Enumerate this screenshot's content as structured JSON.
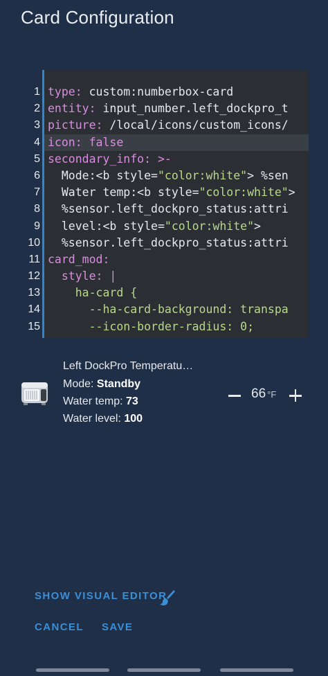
{
  "header": {
    "title": "Card Configuration"
  },
  "editor": {
    "line_numbers": [
      "1",
      "2",
      "3",
      "4",
      "5",
      "6",
      "7",
      "8",
      "9",
      "10",
      "11",
      "12",
      "13",
      "14",
      "15"
    ],
    "lines": [
      {
        "indent": "",
        "parts": [
          {
            "c": "k",
            "t": "type:"
          },
          {
            "c": "p",
            "t": " custom:numberbox-card"
          }
        ]
      },
      {
        "indent": "",
        "parts": [
          {
            "c": "k",
            "t": "entity:"
          },
          {
            "c": "p",
            "t": " input_number.left_dockpro_t"
          }
        ]
      },
      {
        "indent": "",
        "parts": [
          {
            "c": "k",
            "t": "picture:"
          },
          {
            "c": "p",
            "t": " /local/icons/custom_icons/"
          }
        ]
      },
      {
        "indent": "",
        "active": true,
        "parts": [
          {
            "c": "k",
            "t": "icon:"
          },
          {
            "c": "p",
            "t": " "
          },
          {
            "c": "k",
            "t": "false"
          }
        ]
      },
      {
        "indent": "",
        "parts": [
          {
            "c": "k",
            "t": "secondary_info:"
          },
          {
            "c": "p",
            "t": " "
          },
          {
            "c": "k",
            "t": ">-"
          }
        ]
      },
      {
        "indent": "  ",
        "parts": [
          {
            "c": "p",
            "t": "Mode:<b style="
          },
          {
            "c": "s",
            "t": "\"color:white\""
          },
          {
            "c": "p",
            "t": "> %sen"
          }
        ]
      },
      {
        "indent": "  ",
        "parts": [
          {
            "c": "p",
            "t": "Water temp:<b style="
          },
          {
            "c": "s",
            "t": "\"color:white\""
          },
          {
            "c": "p",
            "t": ">"
          }
        ]
      },
      {
        "indent": "  ",
        "parts": [
          {
            "c": "p",
            "t": "%sensor.left_dockpro_status:attri"
          }
        ]
      },
      {
        "indent": "  ",
        "parts": [
          {
            "c": "p",
            "t": "level:<b style="
          },
          {
            "c": "s",
            "t": "\"color:white\""
          },
          {
            "c": "p",
            "t": ">"
          }
        ]
      },
      {
        "indent": "  ",
        "parts": [
          {
            "c": "p",
            "t": "%sensor.left_dockpro_status:attri"
          }
        ]
      },
      {
        "indent": "",
        "parts": [
          {
            "c": "k",
            "t": "card_mod:"
          }
        ]
      },
      {
        "indent": "  ",
        "parts": [
          {
            "c": "k",
            "t": "style:"
          },
          {
            "c": "p",
            "t": " "
          },
          {
            "c": "k",
            "t": "|"
          }
        ]
      },
      {
        "indent": "    ",
        "parts": [
          {
            "c": "s",
            "t": "ha-card {"
          }
        ]
      },
      {
        "indent": "      ",
        "parts": [
          {
            "c": "s",
            "t": "--ha-card-background: transpa"
          }
        ]
      },
      {
        "indent": "      ",
        "parts": [
          {
            "c": "s",
            "t": "--icon-border-radius: 0;"
          }
        ]
      }
    ]
  },
  "card": {
    "name": "Left DockPro Temperatu…",
    "mode_label": "Mode: ",
    "mode_value": "Standby",
    "temp_label": "Water temp: ",
    "temp_value": "73",
    "level_label": "Water level: ",
    "level_value": "100",
    "value": "66",
    "unit": "°F",
    "device_icon": "water-dock-device-icon"
  },
  "actions": {
    "show_visual_editor": "SHOW VISUAL EDITOR",
    "cancel": "CANCEL",
    "save": "SAVE"
  },
  "colors": {
    "background": "#1f2f47",
    "editor_background": "#2b2f33",
    "accent": "#3b8fd6",
    "keyword": "#d98de0",
    "string": "#b8d98a"
  }
}
